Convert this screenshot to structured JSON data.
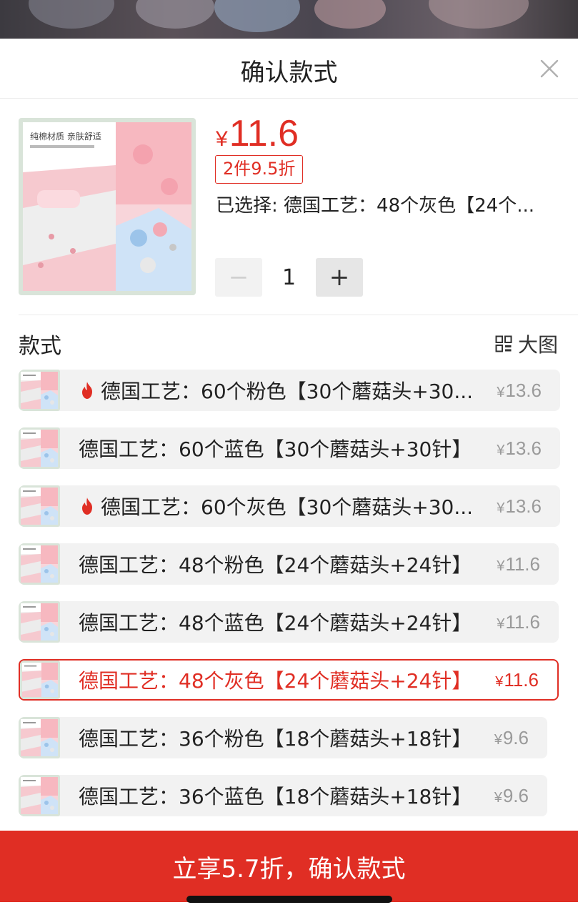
{
  "header": {
    "title": "确认款式"
  },
  "product": {
    "price": "11.6",
    "currency": "¥",
    "discount_badge": "2件9.5折",
    "selected_label": "已选择: 德国工艺：48个灰色【24个...",
    "quantity": "1",
    "minus_symbol": "−",
    "plus_symbol": "+",
    "image_caption": "纯棉材质 亲肤舒适"
  },
  "section": {
    "title": "款式",
    "view_toggle_label": "大图"
  },
  "variants": [
    {
      "name": "德国工艺：60个粉色【30个蘑菇头+30...",
      "price": "13.6",
      "hot": true,
      "selected": false
    },
    {
      "name": "德国工艺：60个蓝色【30个蘑菇头+30针】",
      "price": "13.6",
      "hot": false,
      "selected": false
    },
    {
      "name": "德国工艺：60个灰色【30个蘑菇头+30...",
      "price": "13.6",
      "hot": true,
      "selected": false
    },
    {
      "name": "德国工艺：48个粉色【24个蘑菇头+24针】",
      "price": "11.6",
      "hot": false,
      "selected": false
    },
    {
      "name": "德国工艺：48个蓝色【24个蘑菇头+24针】",
      "price": "11.6",
      "hot": false,
      "selected": false
    },
    {
      "name": "德国工艺：48个灰色【24个蘑菇头+24针】",
      "price": "11.6",
      "hot": false,
      "selected": true
    },
    {
      "name": "德国工艺：36个粉色【18个蘑菇头+18针】",
      "price": "9.6",
      "hot": false,
      "selected": false
    },
    {
      "name": "德国工艺：36个蓝色【18个蘑菇头+18针】",
      "price": "9.6",
      "hot": false,
      "selected": false
    }
  ],
  "cta": {
    "label": "立享5.7折，确认款式"
  },
  "colors": {
    "accent": "#e02e24",
    "row_bg": "#f2f2f2",
    "muted_price": "#9a9a9a"
  },
  "icons": {
    "close": "close-icon",
    "grid": "grid-icon",
    "flame": "flame-icon"
  }
}
